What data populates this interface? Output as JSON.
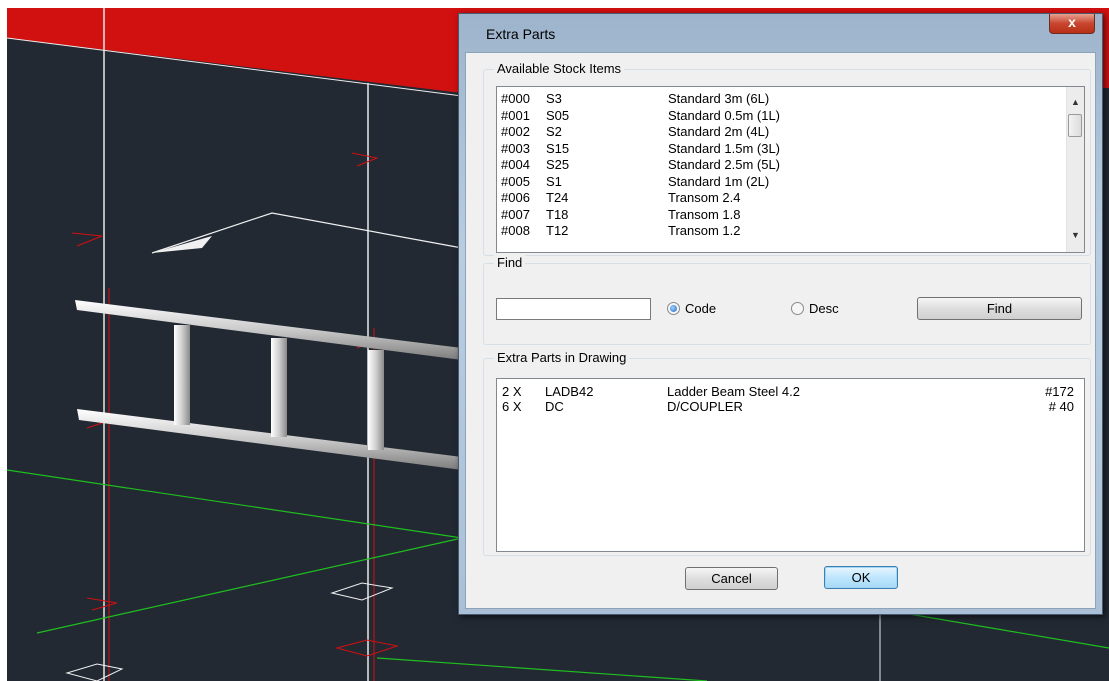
{
  "dialog": {
    "title": "Extra Parts",
    "close_label": "x"
  },
  "stock": {
    "label": "Available Stock Items",
    "items": [
      {
        "num": "#000",
        "code": "S3",
        "desc": "Standard 3m (6L)"
      },
      {
        "num": "#001",
        "code": "S05",
        "desc": "Standard 0.5m (1L)"
      },
      {
        "num": "#002",
        "code": "S2",
        "desc": "Standard 2m (4L)"
      },
      {
        "num": "#003",
        "code": "S15",
        "desc": "Standard 1.5m (3L)"
      },
      {
        "num": "#004",
        "code": "S25",
        "desc": "Standard 2.5m (5L)"
      },
      {
        "num": "#005",
        "code": "S1",
        "desc": "Standard 1m (2L)"
      },
      {
        "num": "#006",
        "code": "T24",
        "desc": "Transom 2.4"
      },
      {
        "num": "#007",
        "code": "T18",
        "desc": "Transom 1.8"
      },
      {
        "num": "#008",
        "code": "T12",
        "desc": "Transom 1.2"
      }
    ]
  },
  "find": {
    "label": "Find",
    "input_value": "",
    "code_label": "Code",
    "desc_label": "Desc",
    "selected": "Code",
    "button_label": "Find"
  },
  "parts": {
    "label": "Extra Parts in Drawing",
    "items": [
      {
        "qty": "2 X",
        "code": "LADB42",
        "desc": "Ladder Beam Steel 4.2",
        "ref": "#172"
      },
      {
        "qty": "6 X",
        "code": "DC",
        "desc": "D/COUPLER",
        "ref": "# 40"
      }
    ]
  },
  "buttons": {
    "cancel": "Cancel",
    "ok": "OK"
  },
  "colors": {
    "cad_background": "#222933",
    "red_face": "#d11010",
    "grid_green": "#1fbf1f"
  }
}
